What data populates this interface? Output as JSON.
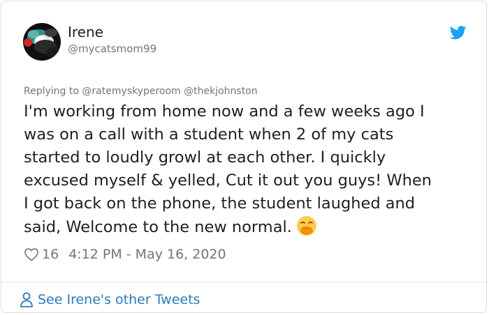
{
  "author": {
    "display_name": "Irene",
    "handle": "@mycatsmom99"
  },
  "reply": {
    "prefix": "Replying to",
    "mentions": [
      "@ratemyskyperoom",
      "@thekjohnston"
    ]
  },
  "tweet": {
    "lines": [
      "I'm working from home now and a few weeks ago I",
      "was on a call with a student when 2 of my cats",
      "started to loudly growl at each other. I quickly",
      "excused myself & yelled, Cut it out you guys! When",
      "I got back on the phone, the student laughed and",
      "said, Welcome to the new normal."
    ],
    "emoji": "face-with-hand-over-mouth-emoji"
  },
  "meta": {
    "likes": "16",
    "timestamp": "4:12 PM - May 16, 2020"
  },
  "footer": {
    "link_label": "See Irene's other Tweets"
  },
  "colors": {
    "text": "#1c2022",
    "secondary": "#697882",
    "link": "#2b7bb9",
    "twitter_blue": "#1da1f2",
    "border": "#d9dfe4"
  },
  "icons": {
    "brand": "twitter-bird-icon",
    "like": "heart-outline-icon",
    "profile": "person-outline-icon"
  }
}
